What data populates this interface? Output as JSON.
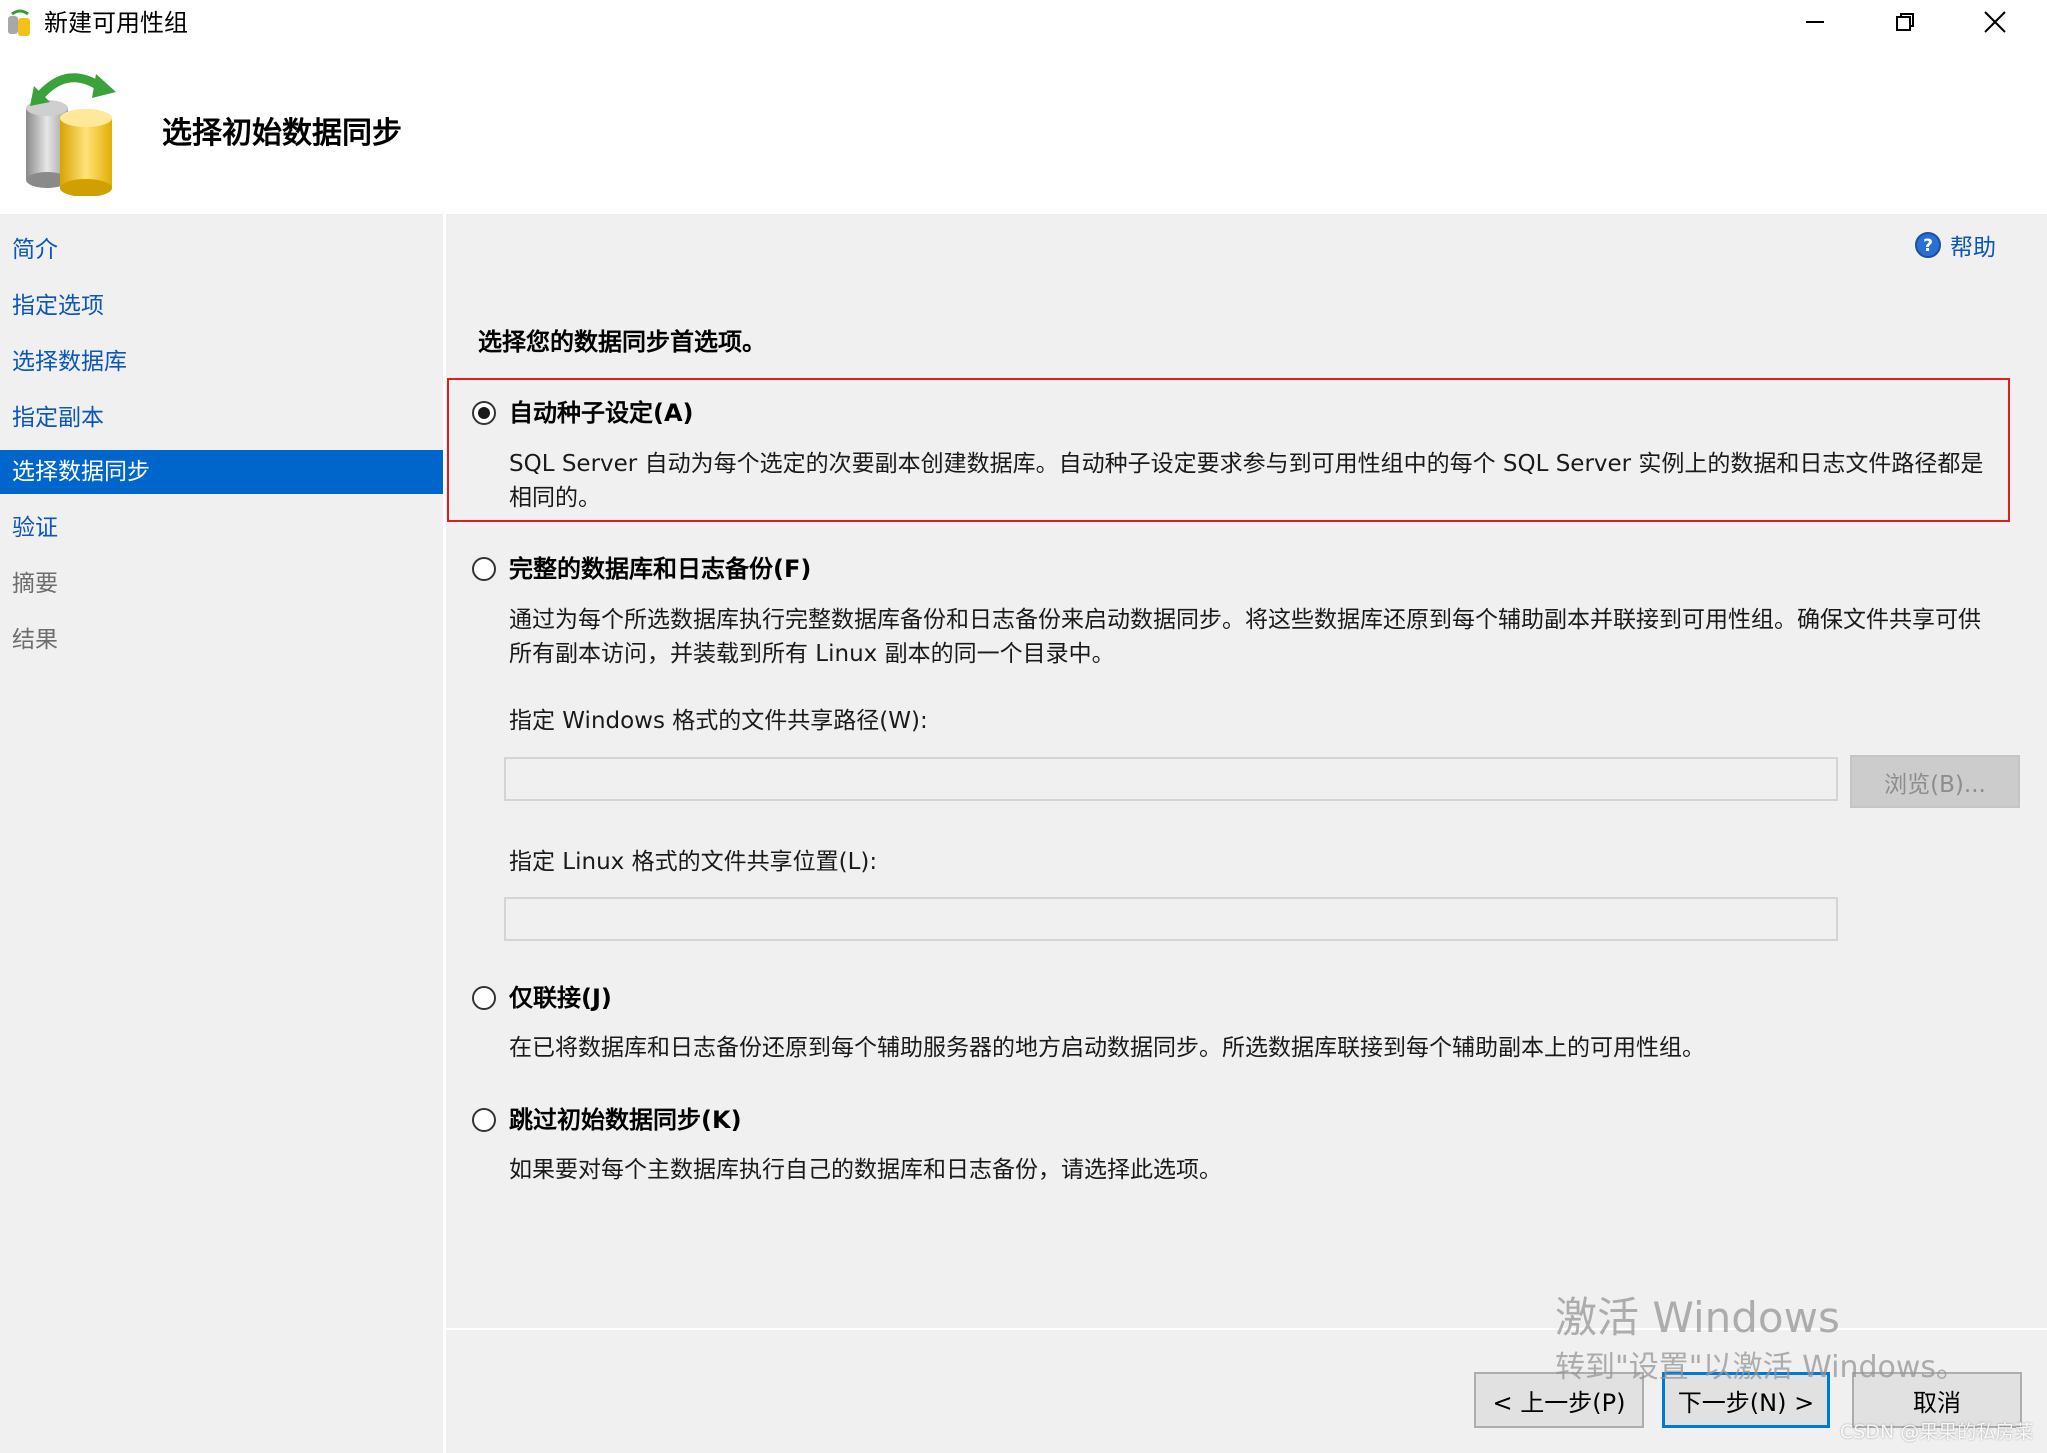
{
  "window": {
    "title": "新建可用性组",
    "icon": "app-icon",
    "controls": [
      "minimize-icon",
      "restore-icon",
      "close-icon"
    ]
  },
  "header": {
    "title": "选择初始数据同步",
    "icon": "database-sync-icon"
  },
  "sidebar": {
    "items": [
      {
        "label": "简介",
        "state": "link"
      },
      {
        "label": "指定选项",
        "state": "link"
      },
      {
        "label": "选择数据库",
        "state": "link"
      },
      {
        "label": "指定副本",
        "state": "link"
      },
      {
        "label": "选择数据同步",
        "state": "active"
      },
      {
        "label": "验证",
        "state": "link"
      },
      {
        "label": "摘要",
        "state": "disabled"
      },
      {
        "label": "结果",
        "state": "disabled"
      }
    ]
  },
  "help": {
    "label": "帮助",
    "icon": "help-icon"
  },
  "main": {
    "prompt": "选择您的数据同步首选项。",
    "options": [
      {
        "label": "自动种子设定(A)",
        "selected": true,
        "description": "SQL Server 自动为每个选定的次要副本创建数据库。自动种子设定要求参与到可用性组中的每个 SQL Server 实例上的数据和日志文件路径都是相同的。"
      },
      {
        "label": "完整的数据库和日志备份(F)",
        "selected": false,
        "description": "通过为每个所选数据库执行完整数据库备份和日志备份来启动数据同步。将这些数据库还原到每个辅助副本并联接到可用性组。确保文件共享可供所有副本访问，并装载到所有 Linux 副本的同一个目录中。"
      },
      {
        "label": "仅联接(J)",
        "selected": false,
        "description": "在已将数据库和日志备份还原到每个辅助服务器的地方启动数据同步。所选数据库联接到每个辅助副本上的可用性组。"
      },
      {
        "label": "跳过初始数据同步(K)",
        "selected": false,
        "description": "如果要对每个主数据库执行自己的数据库和日志备份，请选择此选项。"
      }
    ],
    "windows_share_label": "指定 Windows 格式的文件共享路径(W):",
    "windows_share_value": "",
    "browse_label": "浏览(B)...",
    "linux_share_label": "指定 Linux 格式的文件共享位置(L):",
    "linux_share_value": ""
  },
  "footer": {
    "prev_label": "< 上一步(P)",
    "next_label": "下一步(N) >",
    "cancel_label": "取消"
  },
  "overlay": {
    "activate_title": "激活 Windows",
    "activate_sub": "转到\"设置\"以激活 Windows。",
    "credit": "CSDN @果果的私房菜"
  },
  "colors": {
    "accent": "#0066cc",
    "link": "#0b56b8",
    "highlight_border": "#e01e1e",
    "panel_bg": "#f0f0f0"
  }
}
